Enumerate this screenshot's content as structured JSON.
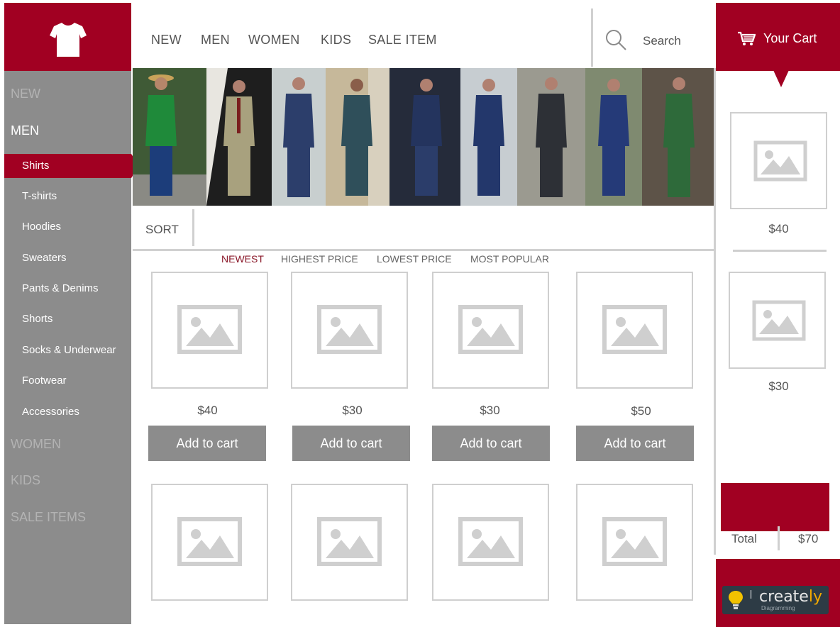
{
  "brand": {
    "logo_icon": "tshirt-icon",
    "colors": {
      "primary": "#a10022",
      "sidebar": "#8c8c8c",
      "button": "#8c8c8c"
    }
  },
  "topnav": {
    "links": [
      "NEW",
      "MEN",
      "WOMEN",
      "KIDS",
      "SALE ITEM"
    ]
  },
  "search": {
    "placeholder": "Search",
    "icon": "search-icon"
  },
  "sidebar": {
    "new": "NEW",
    "men": "MEN",
    "sub_items": [
      "Shirts",
      "T-shirts",
      "Hoodies",
      "Sweaters",
      "Pants & Denims",
      "Shorts",
      "Socks & Underwear",
      "Footwear",
      "Accessories"
    ],
    "women": "WOMEN",
    "kids": "KIDS",
    "sale": "SALE ITEMS",
    "selected": "Shirts"
  },
  "sort": {
    "label": "SORT",
    "options": [
      "NEWEST",
      "HIGHEST PRICE",
      "LOWEST PRICE",
      "MOST POPULAR"
    ],
    "active": "NEWEST"
  },
  "products": {
    "row1": [
      {
        "price": "$40",
        "button": "Add to cart"
      },
      {
        "price": "$30",
        "button": "Add to cart"
      },
      {
        "price": "$30",
        "button": "Add to cart"
      },
      {
        "price": "$50",
        "button": "Add to cart"
      }
    ]
  },
  "cart": {
    "title": "Your Cart",
    "items": [
      {
        "price": "$40"
      },
      {
        "price": "$30"
      }
    ],
    "total_label": "Total",
    "total_value": "$70"
  },
  "badge": {
    "name_a": "create",
    "name_b": "ly",
    "sub": "Diagramming"
  }
}
